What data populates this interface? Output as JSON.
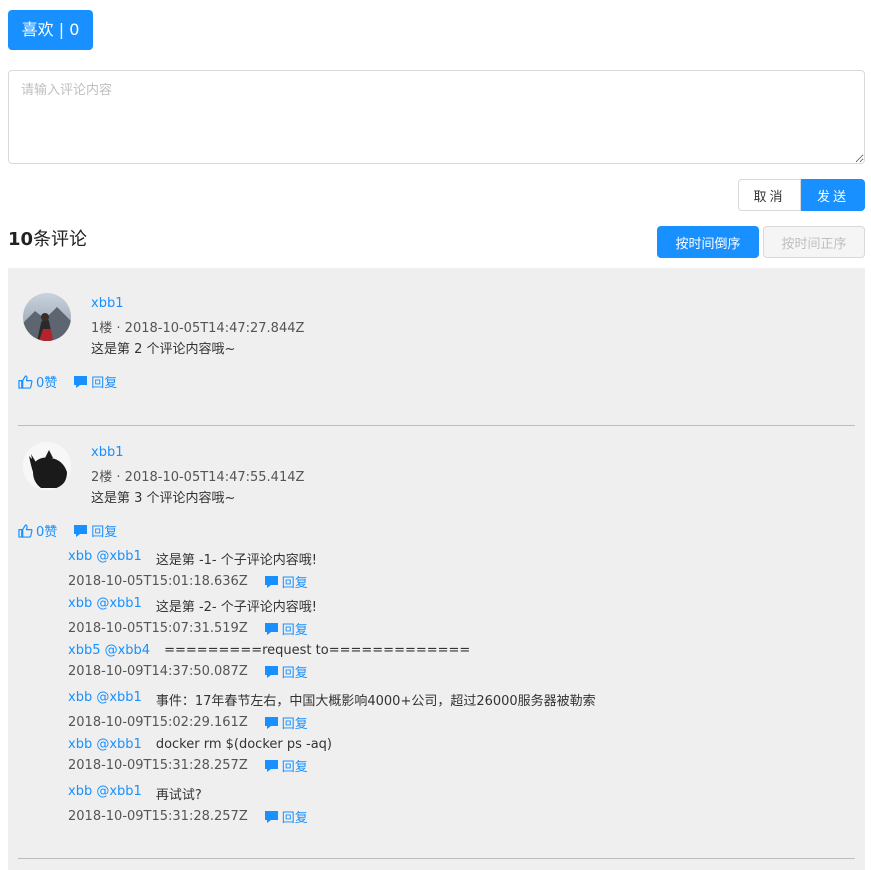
{
  "like": {
    "label": "喜欢 | 0"
  },
  "editor": {
    "placeholder": "请输入评论内容",
    "value": ""
  },
  "buttons": {
    "cancel": "取消",
    "send": "发送"
  },
  "header": {
    "count_number": "10",
    "count_suffix": "条评论"
  },
  "sort": {
    "desc": "按时间倒序",
    "asc": "按时间正序"
  },
  "colors": {
    "accent": "#1890ff",
    "panel": "#efefef"
  },
  "comments": [
    {
      "author": "xbb1",
      "meta": "1楼 · 2018-10-05T14:47:27.844Z",
      "content": "这是第 2 个评论内容哦~",
      "likes": "0赞",
      "reply_label": "回复",
      "avatar_icon": "mountain-photo-avatar",
      "replies": []
    },
    {
      "author": "xbb1",
      "meta": "2楼 · 2018-10-05T14:47:55.414Z",
      "content": "这是第 3 个评论内容哦~",
      "likes": "0赞",
      "reply_label": "回复",
      "avatar_icon": "black-cat-avatar",
      "replies": [
        {
          "author": "xbb @xbb1",
          "text": "这是第 -1- 个子评论内容哦!",
          "time": "2018-10-05T15:01:18.636Z",
          "reply_label": "回复"
        },
        {
          "author": "xbb @xbb1",
          "text": "这是第 -2- 个子评论内容哦!",
          "time": "2018-10-05T15:07:31.519Z",
          "reply_label": "回复"
        },
        {
          "author": "xbb5 @xbb4",
          "text": "=========request to=============",
          "time": "2018-10-09T14:37:50.087Z",
          "reply_label": "回复"
        },
        {
          "author": "xbb @xbb1",
          "text": "事件：17年春节左右，中国大概影响4000+公司，超过26000服务器被勒索",
          "time": "2018-10-09T15:02:29.161Z",
          "reply_label": "回复"
        },
        {
          "author": "xbb @xbb1",
          "text": "docker rm $(docker ps -aq)",
          "time": "2018-10-09T15:31:28.257Z",
          "reply_label": "回复"
        },
        {
          "author": "xbb @xbb1",
          "text": "再试试?",
          "time": "2018-10-09T15:31:28.257Z",
          "reply_label": "回复"
        }
      ]
    }
  ]
}
